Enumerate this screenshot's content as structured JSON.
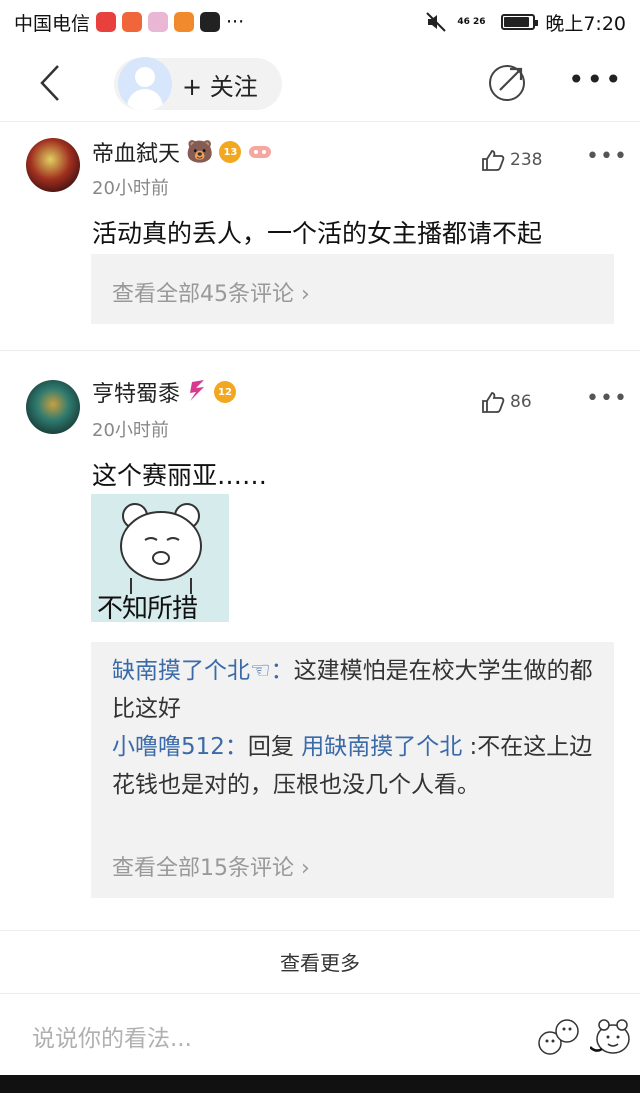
{
  "status_bar": {
    "carrier": "中国电信",
    "network": "46 26",
    "time": "晚上7:20",
    "more": "···"
  },
  "nav": {
    "follow_label": "+ 关注"
  },
  "comments": [
    {
      "username": "帝血弑天",
      "level": "13",
      "time": "20小时前",
      "likes": "238",
      "text": "活动真的丢人，一个活的女主播都请不起",
      "view_all": "查看全部45条评论"
    },
    {
      "username": "亨特蜀黍",
      "level": "12",
      "time": "20小时前",
      "likes": "86",
      "text": "这个赛丽亚……",
      "image_caption": "不知所措",
      "replies": [
        {
          "name": "缺南摸了个北",
          "sep": "：",
          "text": "这建模怕是在校大学生做的都比这好"
        },
        {
          "name": "小噜噜512",
          "sep": "：",
          "prefix": "回复 ",
          "target": "用缺南摸了个北",
          "text": " :不在这上边花钱也是对的，压根也没几个人看。"
        }
      ],
      "view_all": "查看全部15条评论"
    }
  ],
  "see_more": "查看更多",
  "input": {
    "placeholder": "说说你的看法..."
  },
  "colors": {
    "link": "#3b6aa8",
    "reply_bg": "#f2f2f2",
    "badge": "#f1a820"
  }
}
